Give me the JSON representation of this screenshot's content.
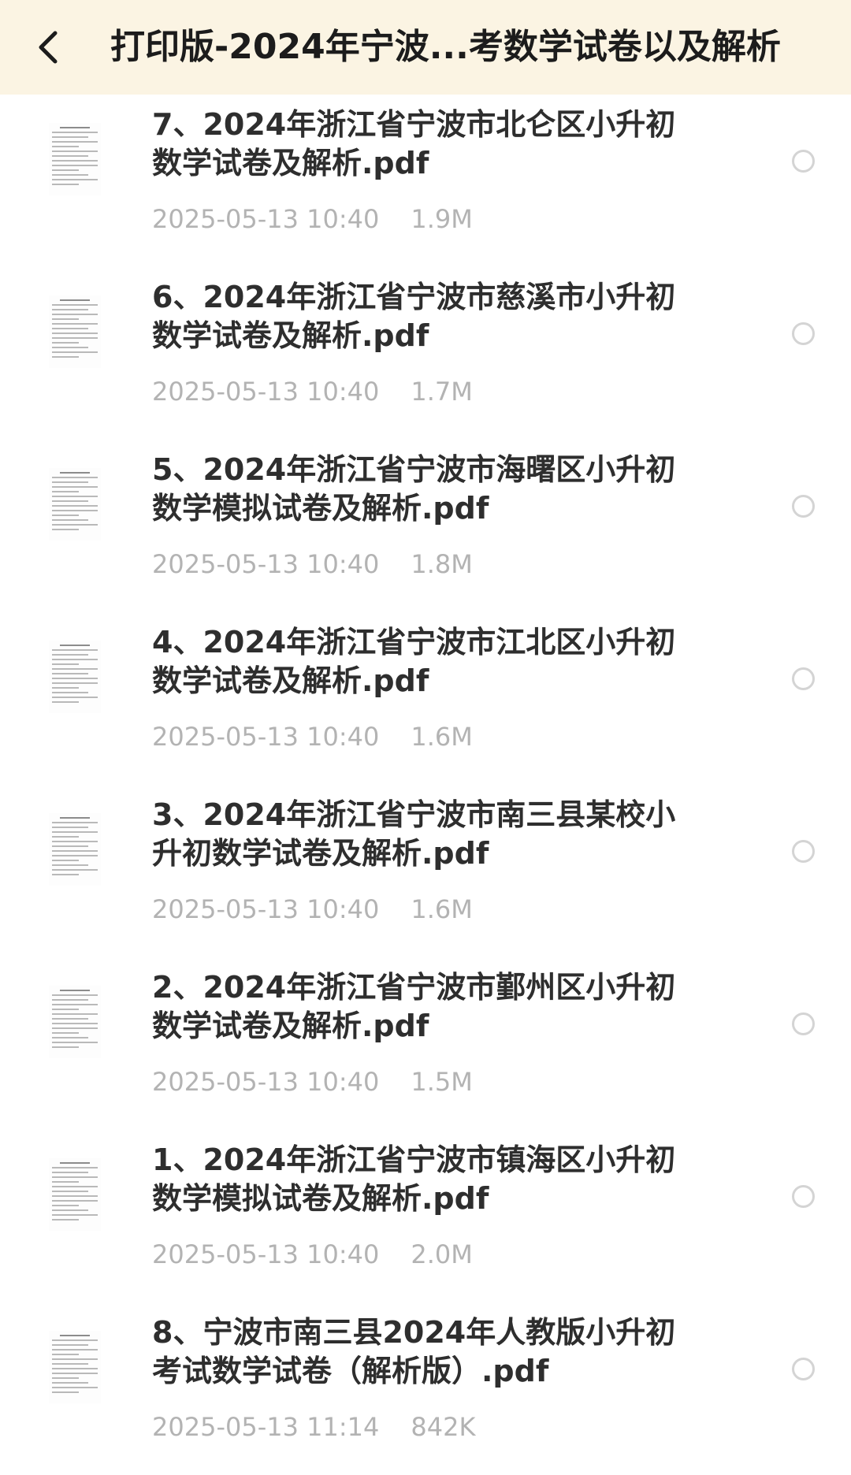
{
  "header": {
    "title": "打印版-2024年宁波...考数学试卷以及解析",
    "back_icon": "chevron-left-icon"
  },
  "files": [
    {
      "name": "7、2024年浙江省宁波市北仑区小升初数学试卷及解析.pdf",
      "date": "2025-05-13 10:40",
      "size": "1.9M",
      "icon": "pdf-thumbnail"
    },
    {
      "name": "6、2024年浙江省宁波市慈溪市小升初数学试卷及解析.pdf",
      "date": "2025-05-13 10:40",
      "size": "1.7M",
      "icon": "pdf-thumbnail"
    },
    {
      "name": "5、2024年浙江省宁波市海曙区小升初数学模拟试卷及解析.pdf",
      "date": "2025-05-13 10:40",
      "size": "1.8M",
      "icon": "pdf-thumbnail"
    },
    {
      "name": "4、2024年浙江省宁波市江北区小升初数学试卷及解析.pdf",
      "date": "2025-05-13 10:40",
      "size": "1.6M",
      "icon": "pdf-thumbnail"
    },
    {
      "name": "3、2024年浙江省宁波市南三县某校小升初数学试卷及解析.pdf",
      "date": "2025-05-13 10:40",
      "size": "1.6M",
      "icon": "pdf-thumbnail"
    },
    {
      "name": "2、2024年浙江省宁波市鄞州区小升初数学试卷及解析.pdf",
      "date": "2025-05-13 10:40",
      "size": "1.5M",
      "icon": "pdf-thumbnail"
    },
    {
      "name": "1、2024年浙江省宁波市镇海区小升初数学模拟试卷及解析.pdf",
      "date": "2025-05-13 10:40",
      "size": "2.0M",
      "icon": "pdf-thumbnail"
    },
    {
      "name": "8、宁波市南三县2024年人教版小升初考试数学试卷（解析版）.pdf",
      "date": "2025-05-13 11:14",
      "size": "842K",
      "icon": "pdf-thumbnail"
    }
  ],
  "colors": {
    "header_bg": "#fbf4e3",
    "title": "#1c1c1c",
    "file_name": "#2e2e2e",
    "meta": "#b3b3b3",
    "radio_border": "#d4d4d4"
  }
}
